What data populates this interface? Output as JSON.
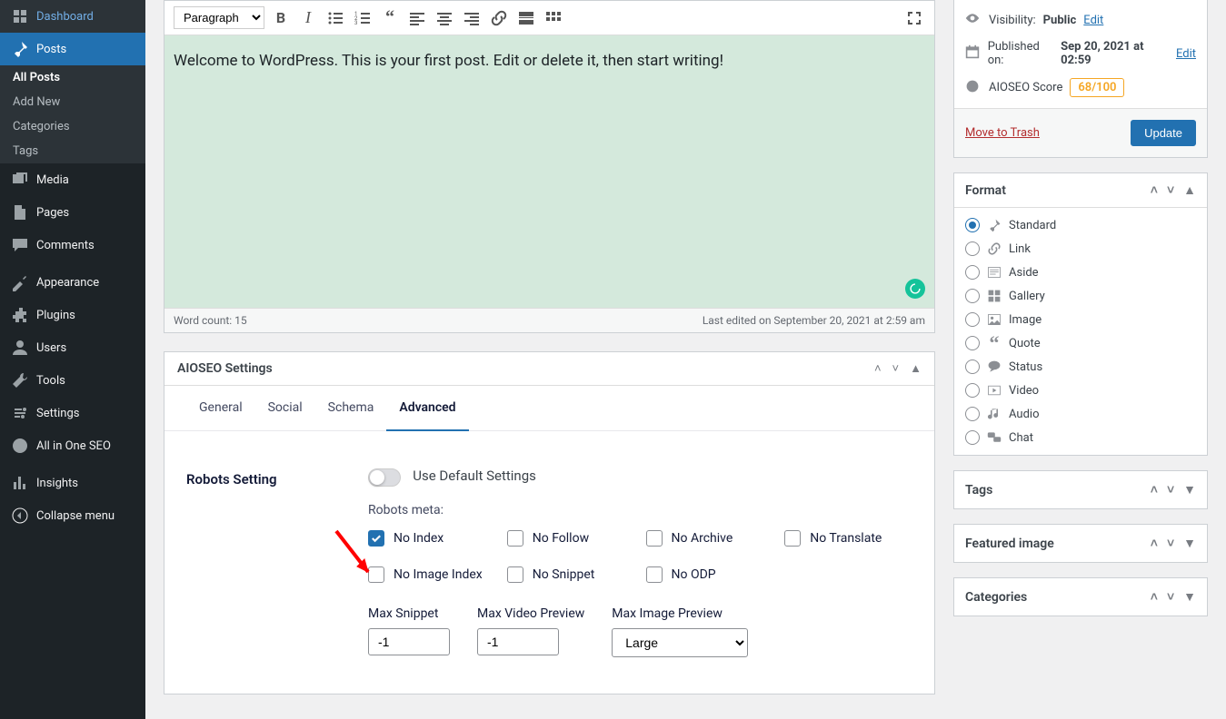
{
  "sidebar": {
    "items": [
      {
        "icon": "dashboard",
        "label": "Dashboard"
      },
      {
        "icon": "pin",
        "label": "Posts",
        "current": true,
        "submenu": [
          {
            "label": "All Posts",
            "current": true
          },
          {
            "label": "Add New"
          },
          {
            "label": "Categories"
          },
          {
            "label": "Tags"
          }
        ]
      },
      {
        "icon": "media",
        "label": "Media"
      },
      {
        "icon": "page",
        "label": "Pages"
      },
      {
        "icon": "comment",
        "label": "Comments"
      },
      {
        "sep": true
      },
      {
        "icon": "appearance",
        "label": "Appearance"
      },
      {
        "icon": "plugin",
        "label": "Plugins"
      },
      {
        "icon": "users",
        "label": "Users"
      },
      {
        "icon": "tools",
        "label": "Tools"
      },
      {
        "icon": "settings",
        "label": "Settings"
      },
      {
        "icon": "aioseo",
        "label": "All in One SEO"
      },
      {
        "sep": true
      },
      {
        "icon": "chart",
        "label": "Insights"
      },
      {
        "icon": "collapse",
        "label": "Collapse menu"
      }
    ]
  },
  "editor": {
    "format_select": "Paragraph",
    "content": "Welcome to WordPress. This is your first post. Edit or delete it, then start writing!",
    "word_count_label": "Word count: 15",
    "last_edited": "Last edited on September 20, 2021 at 2:59 am"
  },
  "aioseo": {
    "title": "AIOSEO Settings",
    "tabs": [
      {
        "label": "General"
      },
      {
        "label": "Social"
      },
      {
        "label": "Schema"
      },
      {
        "label": "Advanced",
        "active": true
      }
    ],
    "robots": {
      "setting_label": "Robots Setting",
      "default_label": "Use Default Settings",
      "meta_label": "Robots meta:",
      "checks": [
        {
          "label": "No Index",
          "checked": true
        },
        {
          "label": "No Follow"
        },
        {
          "label": "No Archive"
        },
        {
          "label": "No Translate"
        },
        {
          "label": "No Image Index"
        },
        {
          "label": "No Snippet"
        },
        {
          "label": "No ODP"
        }
      ],
      "max_snippet": {
        "label": "Max Snippet",
        "value": "-1"
      },
      "max_video": {
        "label": "Max Video Preview",
        "value": "-1"
      },
      "max_image": {
        "label": "Max Image Preview",
        "value": "Large"
      }
    }
  },
  "publish": {
    "visibility": {
      "label": "Visibility:",
      "value": "Public",
      "edit": "Edit"
    },
    "published": {
      "label": "Published on:",
      "value": "Sep 20, 2021 at 02:59",
      "edit": "Edit"
    },
    "score": {
      "label": "AIOSEO Score",
      "value": "68/100"
    },
    "trash": "Move to Trash",
    "update": "Update"
  },
  "format_box": {
    "title": "Format",
    "items": [
      {
        "label": "Standard",
        "icon": "pin",
        "checked": true
      },
      {
        "label": "Link",
        "icon": "link"
      },
      {
        "label": "Aside",
        "icon": "aside"
      },
      {
        "label": "Gallery",
        "icon": "gallery"
      },
      {
        "label": "Image",
        "icon": "image"
      },
      {
        "label": "Quote",
        "icon": "quote"
      },
      {
        "label": "Status",
        "icon": "status"
      },
      {
        "label": "Video",
        "icon": "video"
      },
      {
        "label": "Audio",
        "icon": "audio"
      },
      {
        "label": "Chat",
        "icon": "chat"
      }
    ]
  },
  "side_boxes": [
    {
      "title": "Tags"
    },
    {
      "title": "Featured image"
    },
    {
      "title": "Categories"
    }
  ]
}
